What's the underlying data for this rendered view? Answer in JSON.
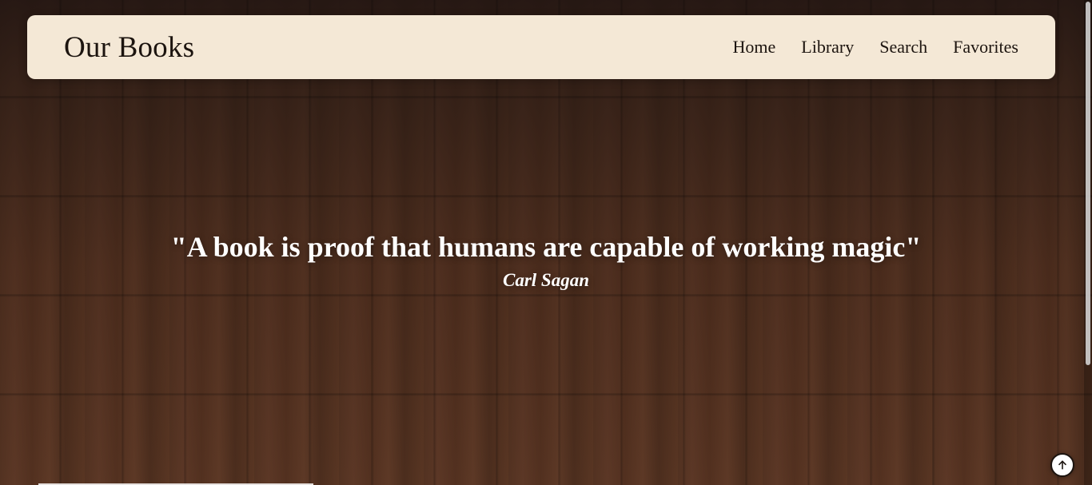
{
  "navbar": {
    "brand": "Our Books",
    "links": [
      "Home",
      "Library",
      "Search",
      "Favorites"
    ]
  },
  "hero": {
    "quote": "\"A book is proof that humans are capable of working magic\"",
    "author": "Carl Sagan"
  },
  "icons": {
    "scroll_to_top": "arrow-up-icon"
  },
  "colors": {
    "navbar_bg": "#f4e8d6",
    "text_dark": "#1c140f",
    "hero_text": "#ffffff"
  }
}
